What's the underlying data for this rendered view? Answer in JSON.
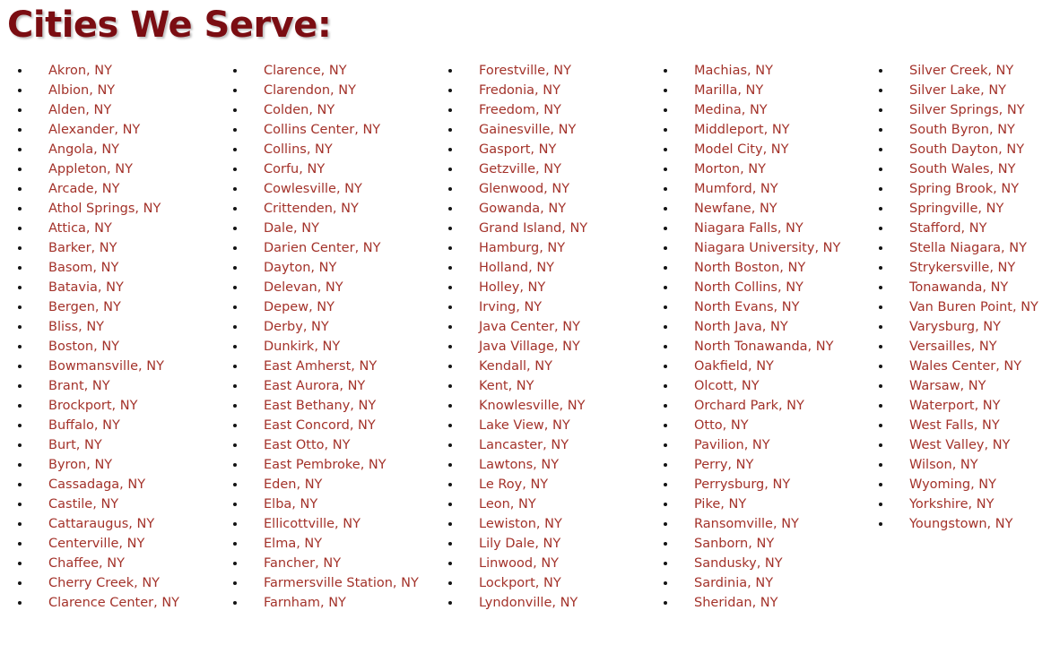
{
  "page": {
    "title": "Cities We Serve:",
    "background_color": "#ffffff",
    "title_color": "#7b0d12",
    "item_color": "#a3322a",
    "bullet_color": "#141414",
    "bullet_glyph": "bullet-dot"
  },
  "columns": [
    {
      "id": "column-1",
      "items": [
        "Akron, NY",
        "Albion, NY",
        "Alden, NY",
        "Alexander, NY",
        "Angola, NY",
        "Appleton, NY",
        "Arcade, NY",
        "Athol Springs, NY",
        "Attica, NY",
        "Barker, NY",
        "Basom, NY",
        "Batavia, NY",
        "Bergen, NY",
        "Bliss, NY",
        "Boston, NY",
        "Bowmansville, NY",
        "Brant, NY",
        "Brockport, NY",
        "Buffalo, NY",
        "Burt, NY",
        "Byron, NY",
        "Cassadaga, NY",
        "Castile, NY",
        "Cattaraugus, NY",
        "Centerville, NY",
        "Chaffee, NY",
        "Cherry Creek, NY",
        "Clarence Center, NY"
      ]
    },
    {
      "id": "column-2",
      "items": [
        "Clarence, NY",
        "Clarendon, NY",
        "Colden, NY",
        "Collins Center, NY",
        "Collins, NY",
        "Corfu, NY",
        "Cowlesville, NY",
        "Crittenden, NY",
        "Dale, NY",
        "Darien Center, NY",
        "Dayton, NY",
        "Delevan, NY",
        "Depew, NY",
        "Derby, NY",
        "Dunkirk, NY",
        "East Amherst, NY",
        "East Aurora, NY",
        "East Bethany, NY",
        "East Concord, NY",
        "East Otto, NY",
        "East Pembroke, NY",
        "Eden, NY",
        "Elba, NY",
        "Ellicottville, NY",
        "Elma, NY",
        "Fancher, NY",
        "Farmersville Station, NY",
        "Farnham, NY"
      ]
    },
    {
      "id": "column-3",
      "items": [
        "Forestville, NY",
        "Fredonia, NY",
        "Freedom, NY",
        "Gainesville, NY",
        "Gasport, NY",
        "Getzville, NY",
        "Glenwood, NY",
        "Gowanda, NY",
        "Grand Island, NY",
        "Hamburg, NY",
        "Holland, NY",
        "Holley, NY",
        "Irving, NY",
        "Java Center, NY",
        "Java Village, NY",
        "Kendall, NY",
        "Kent, NY",
        "Knowlesville, NY",
        "Lake View, NY",
        "Lancaster, NY",
        "Lawtons, NY",
        "Le Roy, NY",
        "Leon, NY",
        "Lewiston, NY",
        "Lily Dale, NY",
        "Linwood, NY",
        "Lockport, NY",
        "Lyndonville, NY"
      ]
    },
    {
      "id": "column-4",
      "items": [
        "Machias, NY",
        "Marilla, NY",
        "Medina, NY",
        "Middleport, NY",
        "Model City, NY",
        "Morton, NY",
        "Mumford, NY",
        "Newfane, NY",
        "Niagara Falls, NY",
        "Niagara University, NY",
        "North Boston, NY",
        "North Collins, NY",
        "North Evans, NY",
        "North Java, NY",
        "North Tonawanda, NY",
        "Oakfield, NY",
        "Olcott, NY",
        "Orchard Park, NY",
        "Otto, NY",
        "Pavilion, NY",
        "Perry, NY",
        "Perrysburg, NY",
        "Pike, NY",
        "Ransomville, NY",
        "Sanborn, NY",
        "Sandusky, NY",
        "Sardinia, NY",
        "Sheridan, NY"
      ]
    },
    {
      "id": "column-5",
      "items": [
        "Silver Creek, NY",
        "Silver Lake, NY",
        "Silver Springs, NY",
        "South Byron, NY",
        "South Dayton, NY",
        "South Wales, NY",
        "Spring Brook, NY",
        "Springville, NY",
        "Stafford, NY",
        "Stella Niagara, NY",
        "Strykersville, NY",
        "Tonawanda, NY",
        "Van Buren Point, NY",
        "Varysburg, NY",
        "Versailles, NY",
        "Wales Center, NY",
        "Warsaw, NY",
        "Waterport, NY",
        "West Falls, NY",
        "West Valley, NY",
        "Wilson, NY",
        "Wyoming, NY",
        "Yorkshire, NY",
        "Youngstown, NY"
      ]
    }
  ]
}
